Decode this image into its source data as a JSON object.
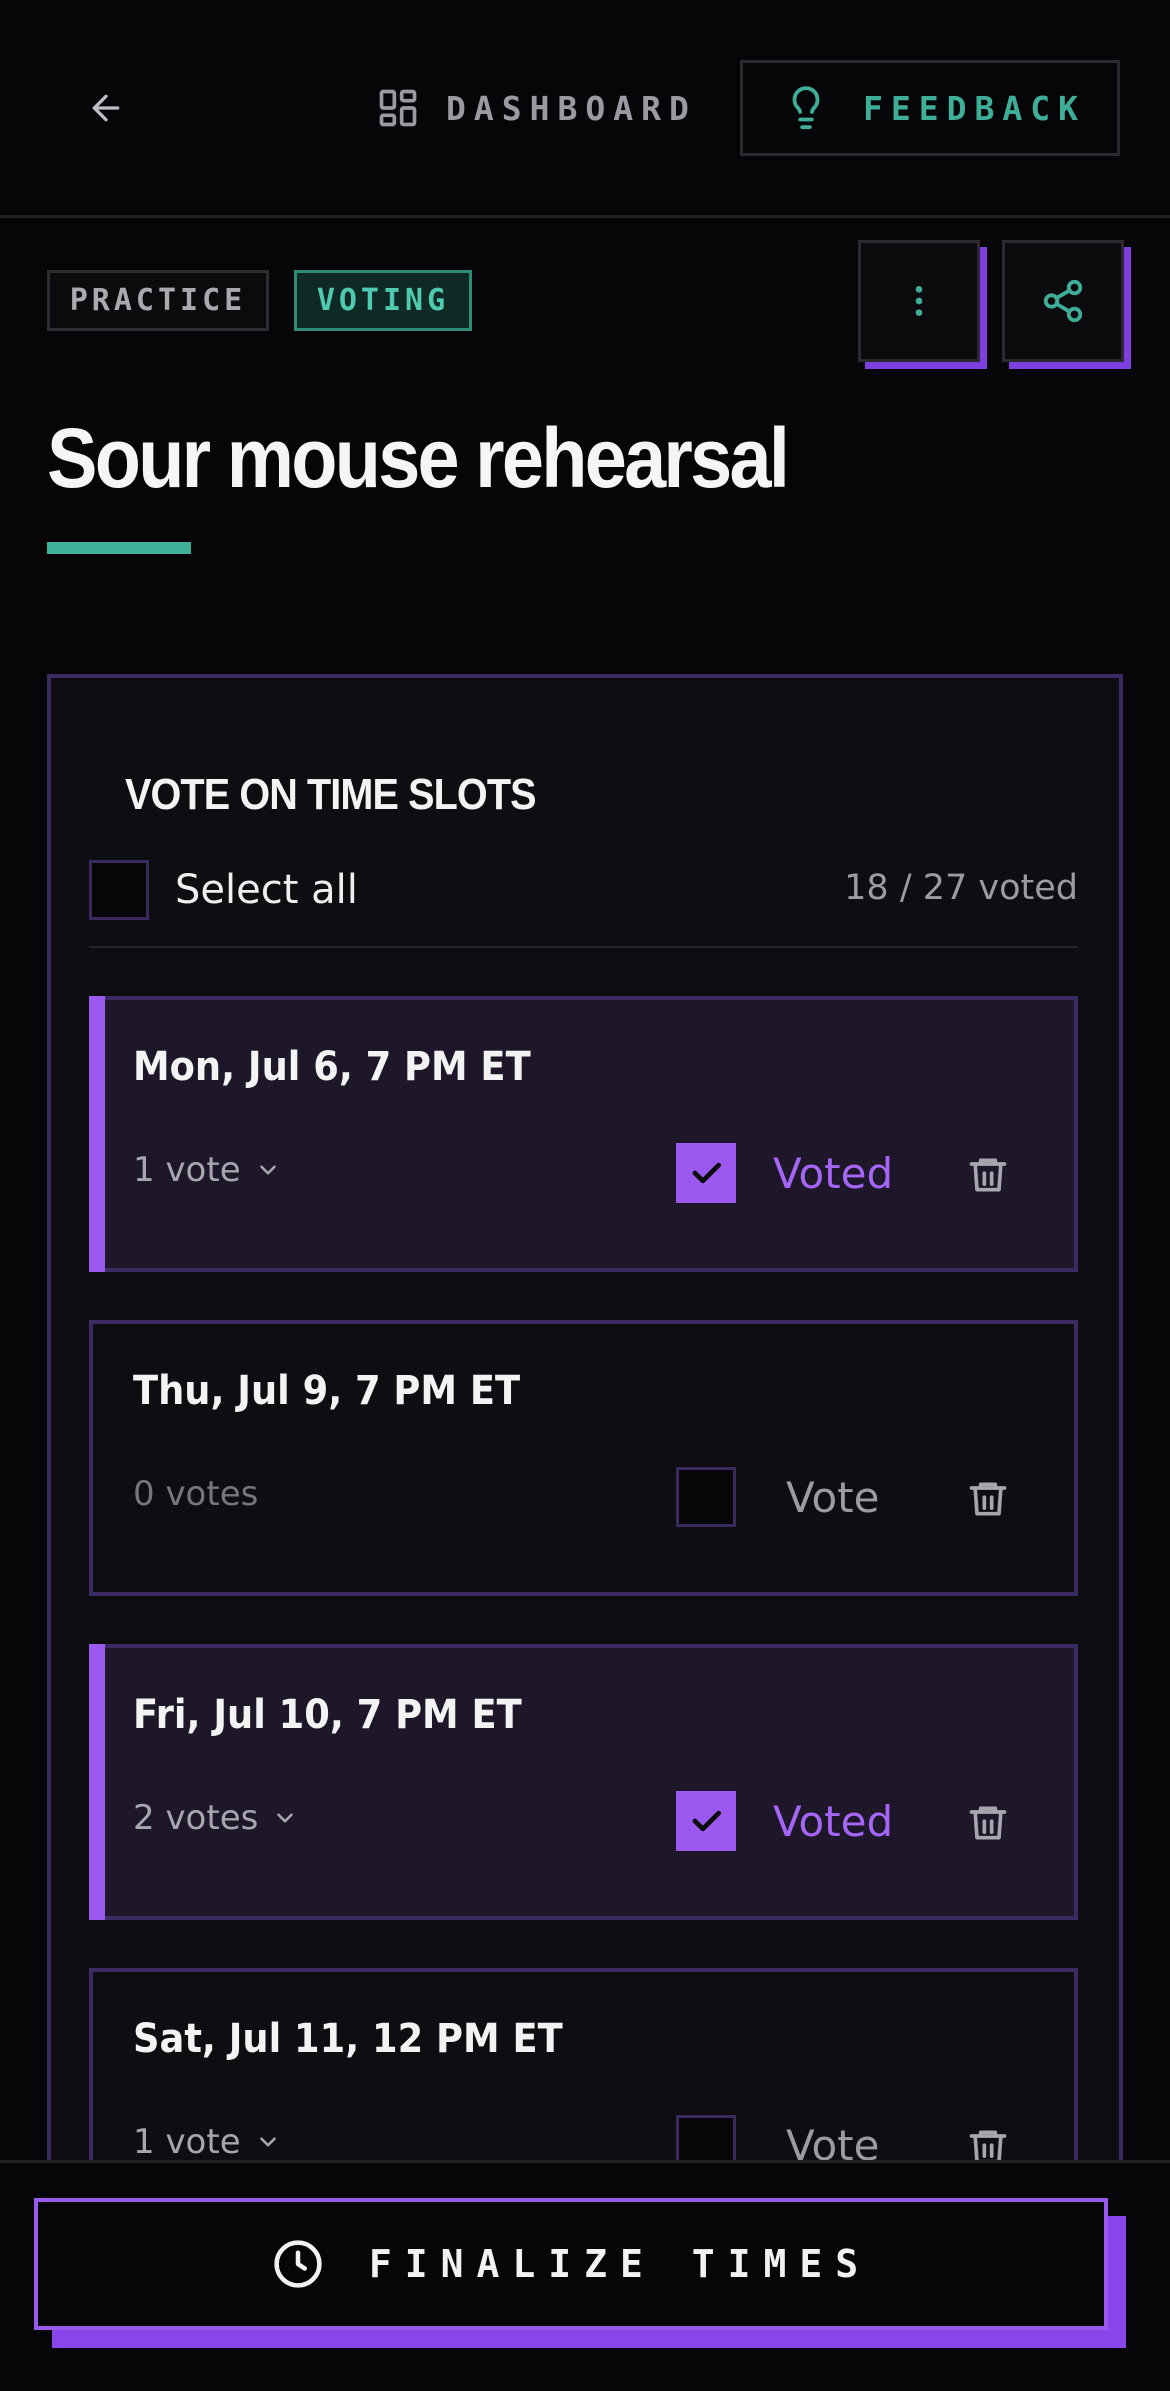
{
  "nav": {
    "dashboard_label": "DASHBOARD",
    "feedback_label": "FEEDBACK"
  },
  "badges": {
    "practice": "PRACTICE",
    "voting": "VOTING"
  },
  "event": {
    "title": "Sour mouse rehearsal"
  },
  "voting": {
    "title": "VOTE ON TIME SLOTS",
    "select_all_label": "Select all",
    "voted_count": "18 / 27 voted",
    "slots": [
      {
        "date": "Mon, Jul 6, 7 PM ET",
        "votes": "1 vote",
        "status": "Voted",
        "voted": true
      },
      {
        "date": "Thu, Jul 9, 7 PM ET",
        "votes": "0 votes",
        "status": "Vote",
        "voted": false
      },
      {
        "date": "Fri, Jul 10, 7 PM ET",
        "votes": "2 votes",
        "status": "Voted",
        "voted": true
      },
      {
        "date": "Sat, Jul 11, 12 PM ET",
        "votes": "1 vote",
        "status": "Vote",
        "voted": false
      }
    ]
  },
  "footer": {
    "finalize_label": "FINALIZE TIMES"
  },
  "colors": {
    "accent_purple": "#9b59f0",
    "accent_teal": "#3fb09a",
    "background": "#060608"
  }
}
